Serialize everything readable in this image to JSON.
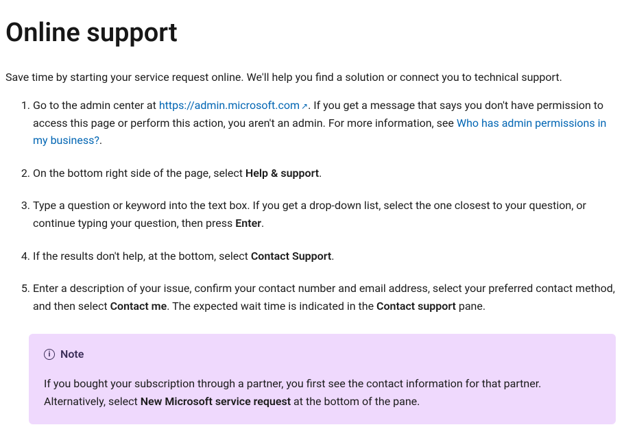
{
  "heading": "Online support",
  "intro": "Save time by starting your service request online. We'll help you find a solution or connect you to technical support.",
  "steps": {
    "s1_pre": "Go to the admin center at ",
    "s1_link": "https://admin.microsoft.com",
    "s1_mid": ". If you get a message that says you don't have permission to access this page or perform this action, you aren't an admin. For more information, see ",
    "s1_link2": "Who has admin permissions in my business?",
    "s1_end": ".",
    "s2_pre": "On the bottom right side of the page, select ",
    "s2_bold": "Help & support",
    "s2_end": ".",
    "s3_pre": "Type a question or keyword into the text box. If you get a drop-down list, select the one closest to your question, or continue typing your question, then press ",
    "s3_bold": "Enter",
    "s3_end": ".",
    "s4_pre": "If the results don't help, at the bottom, select ",
    "s4_bold": "Contact Support",
    "s4_end": ".",
    "s5_pre": "Enter a description of your issue, confirm your contact number and email address, select your preferred contact method, and then select ",
    "s5_bold": "Contact me",
    "s5_mid": ". The expected wait time is indicated in the ",
    "s5_bold2": "Contact support",
    "s5_end": " pane."
  },
  "note": {
    "label": "Note",
    "body_pre": "If you bought your subscription through a partner, you first see the contact information for that partner. Alternatively, select ",
    "body_bold": "New Microsoft service request",
    "body_end": " at the bottom of the pane."
  }
}
